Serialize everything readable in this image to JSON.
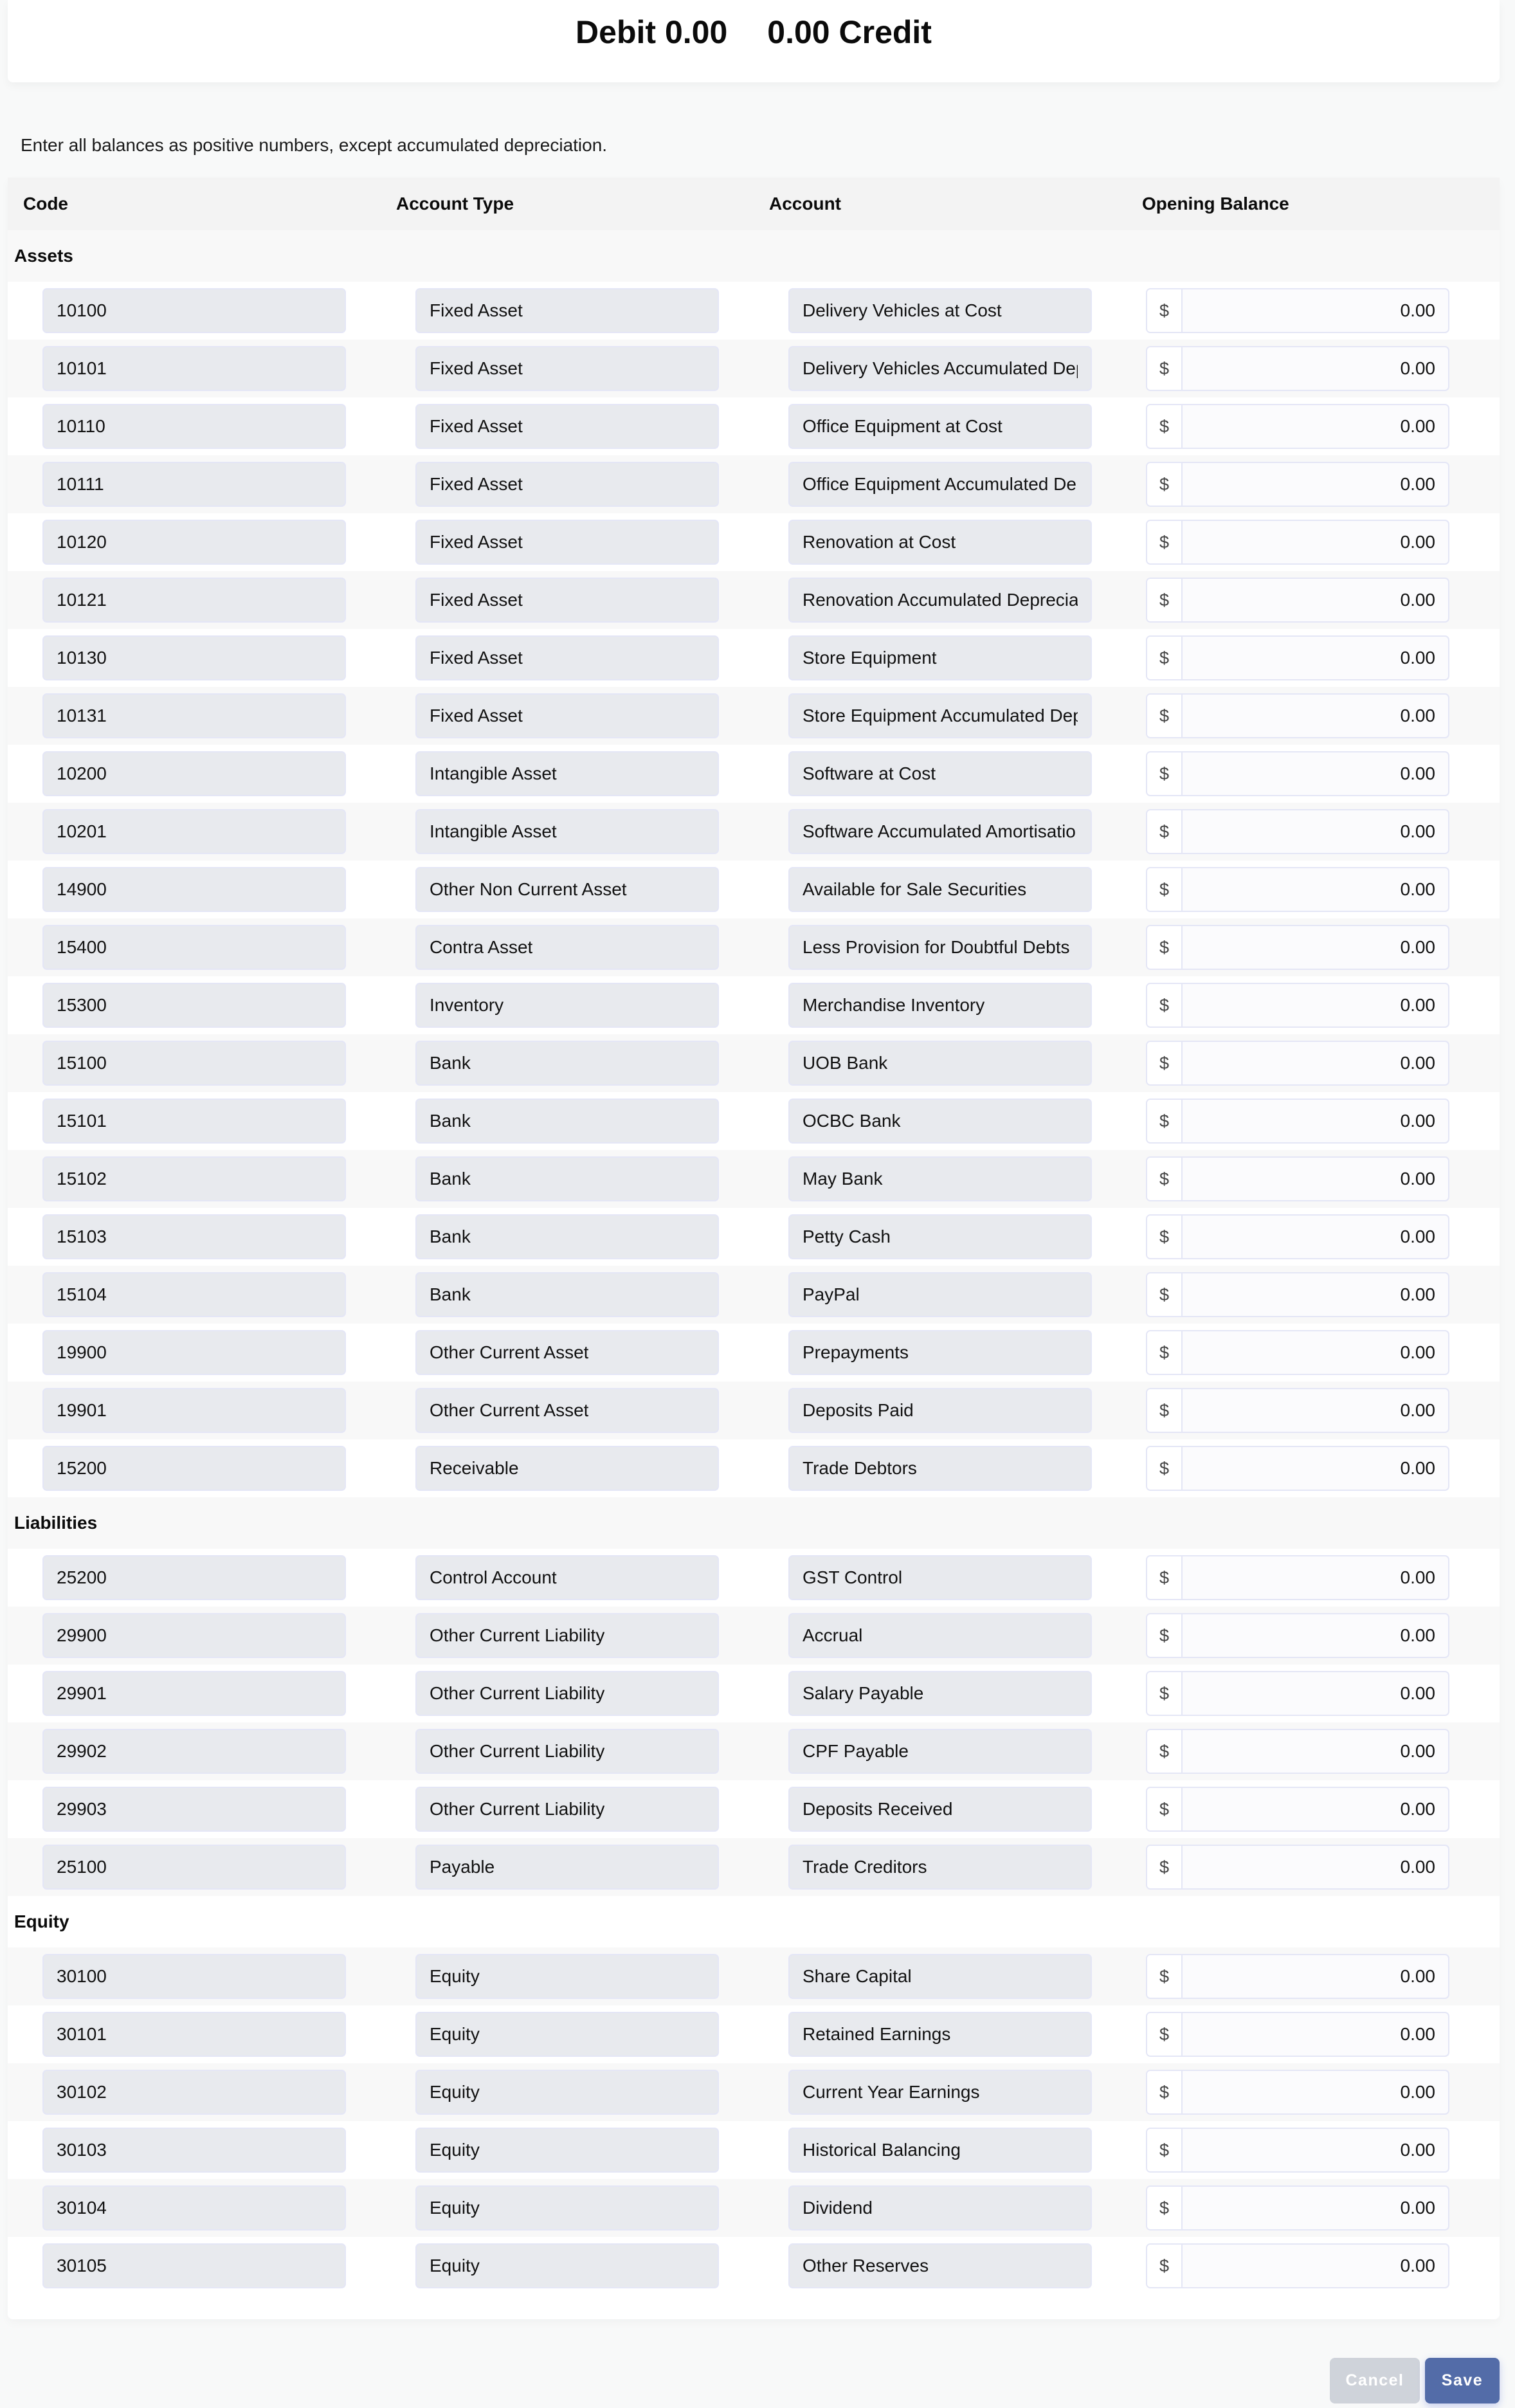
{
  "totals": {
    "debit_label": "Debit",
    "debit_value": "0.00",
    "credit_value": "0.00",
    "credit_label": "Credit"
  },
  "instruction": "Enter all balances as positive numbers, except accumulated depreciation.",
  "table": {
    "headers": [
      "Code",
      "Account Type",
      "Account",
      "Opening Balance"
    ],
    "currency_symbol": "$",
    "sections": [
      {
        "title": "Assets",
        "rows": [
          {
            "code": "10100",
            "type": "Fixed Asset",
            "account": "Delivery Vehicles at Cost",
            "balance": "0.00"
          },
          {
            "code": "10101",
            "type": "Fixed Asset",
            "account": "Delivery Vehicles Accumulated Dep",
            "balance": "0.00"
          },
          {
            "code": "10110",
            "type": "Fixed Asset",
            "account": "Office Equipment at Cost",
            "balance": "0.00"
          },
          {
            "code": "10111",
            "type": "Fixed Asset",
            "account": "Office Equipment Accumulated De",
            "balance": "0.00"
          },
          {
            "code": "10120",
            "type": "Fixed Asset",
            "account": "Renovation at Cost",
            "balance": "0.00"
          },
          {
            "code": "10121",
            "type": "Fixed Asset",
            "account": "Renovation Accumulated Deprecia",
            "balance": "0.00"
          },
          {
            "code": "10130",
            "type": "Fixed Asset",
            "account": "Store Equipment",
            "balance": "0.00"
          },
          {
            "code": "10131",
            "type": "Fixed Asset",
            "account": "Store Equipment Accumulated Dep",
            "balance": "0.00"
          },
          {
            "code": "10200",
            "type": "Intangible Asset",
            "account": "Software at Cost",
            "balance": "0.00"
          },
          {
            "code": "10201",
            "type": "Intangible Asset",
            "account": "Software Accumulated Amortisatio",
            "balance": "0.00"
          },
          {
            "code": "14900",
            "type": "Other Non Current Asset",
            "account": "Available for Sale Securities",
            "balance": "0.00"
          },
          {
            "code": "15400",
            "type": "Contra Asset",
            "account": "Less Provision for Doubtful Debts",
            "balance": "0.00"
          },
          {
            "code": "15300",
            "type": "Inventory",
            "account": "Merchandise Inventory",
            "balance": "0.00"
          },
          {
            "code": "15100",
            "type": "Bank",
            "account": "UOB Bank",
            "balance": "0.00"
          },
          {
            "code": "15101",
            "type": "Bank",
            "account": "OCBC Bank",
            "balance": "0.00"
          },
          {
            "code": "15102",
            "type": "Bank",
            "account": "May Bank",
            "balance": "0.00"
          },
          {
            "code": "15103",
            "type": "Bank",
            "account": "Petty Cash",
            "balance": "0.00"
          },
          {
            "code": "15104",
            "type": "Bank",
            "account": "PayPal",
            "balance": "0.00"
          },
          {
            "code": "19900",
            "type": "Other Current Asset",
            "account": "Prepayments",
            "balance": "0.00"
          },
          {
            "code": "19901",
            "type": "Other Current Asset",
            "account": "Deposits Paid",
            "balance": "0.00"
          },
          {
            "code": "15200",
            "type": "Receivable",
            "account": "Trade Debtors",
            "balance": "0.00"
          }
        ]
      },
      {
        "title": "Liabilities",
        "rows": [
          {
            "code": "25200",
            "type": "Control Account",
            "account": "GST Control",
            "balance": "0.00"
          },
          {
            "code": "29900",
            "type": "Other Current Liability",
            "account": "Accrual",
            "balance": "0.00"
          },
          {
            "code": "29901",
            "type": "Other Current Liability",
            "account": "Salary Payable",
            "balance": "0.00"
          },
          {
            "code": "29902",
            "type": "Other Current Liability",
            "account": "CPF Payable",
            "balance": "0.00"
          },
          {
            "code": "29903",
            "type": "Other Current Liability",
            "account": "Deposits Received",
            "balance": "0.00"
          },
          {
            "code": "25100",
            "type": "Payable",
            "account": "Trade Creditors",
            "balance": "0.00"
          }
        ]
      },
      {
        "title": "Equity",
        "rows": [
          {
            "code": "30100",
            "type": "Equity",
            "account": "Share Capital",
            "balance": "0.00"
          },
          {
            "code": "30101",
            "type": "Equity",
            "account": "Retained Earnings",
            "balance": "0.00"
          },
          {
            "code": "30102",
            "type": "Equity",
            "account": "Current Year Earnings",
            "balance": "0.00"
          },
          {
            "code": "30103",
            "type": "Equity",
            "account": "Historical Balancing",
            "balance": "0.00"
          },
          {
            "code": "30104",
            "type": "Equity",
            "account": "Dividend",
            "balance": "0.00"
          },
          {
            "code": "30105",
            "type": "Equity",
            "account": "Other Reserves",
            "balance": "0.00"
          }
        ]
      }
    ]
  },
  "actions": {
    "cancel_label": "Cancel",
    "save_label": "Save"
  },
  "colors": {
    "save_button": "#536ca8",
    "cancel_button": "#cfd3da",
    "readonly_field": "#e8eaee",
    "header_bg": "#f3f3f3"
  }
}
